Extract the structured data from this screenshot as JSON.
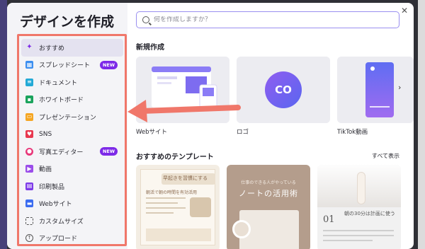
{
  "title": "デザインを作成",
  "search": {
    "placeholder": "何を作成しますか？"
  },
  "sidebar": {
    "items": [
      {
        "label": "おすすめ",
        "icon": "sparkle-icon",
        "color": "#7d2ae8"
      },
      {
        "label": "スプレッドシート",
        "icon": "spreadsheet-icon",
        "color": "#3b8ef0",
        "badge": "NEW"
      },
      {
        "label": "ドキュメント",
        "icon": "document-icon",
        "color": "#22a9d6"
      },
      {
        "label": "ホワイトボード",
        "icon": "whiteboard-icon",
        "color": "#1aa35c"
      },
      {
        "label": "プレゼンテーション",
        "icon": "presentation-icon",
        "color": "#f5a623"
      },
      {
        "label": "SNS",
        "icon": "heart-icon",
        "color": "#e8384f"
      },
      {
        "label": "写真エディター",
        "icon": "camera-icon",
        "color": "#e8387a",
        "badge": "NEW"
      },
      {
        "label": "動画",
        "icon": "video-icon",
        "color": "#9b4dea"
      },
      {
        "label": "印刷製品",
        "icon": "printer-icon",
        "color": "#7d3ae8"
      },
      {
        "label": "Webサイト",
        "icon": "monitor-icon",
        "color": "#3b6cf0"
      },
      {
        "label": "カスタムサイズ",
        "icon": "resize-icon",
        "color": "#555"
      },
      {
        "label": "アップロード",
        "icon": "upload-icon",
        "color": "#555"
      }
    ]
  },
  "new_design": {
    "title": "新規作成",
    "cards": [
      {
        "label": "Webサイト"
      },
      {
        "label": "ロゴ",
        "logo_text": "CO"
      },
      {
        "label": "TikTok動画"
      }
    ]
  },
  "templates": {
    "title": "おすすめのテンプレート",
    "see_all": "すべて表示",
    "t1": {
      "heading": "早起きを習慣にする",
      "sub": "朝活で朝の時間を有効活用"
    },
    "t2": {
      "caption": "仕事のできる人がやっている",
      "heading": "ノートの活用術"
    },
    "t3": {
      "number": "01",
      "heading": "朝の30分は計画に使う"
    }
  },
  "colors": {
    "accent": "#7d2ae8",
    "highlight": "#f0776a"
  }
}
